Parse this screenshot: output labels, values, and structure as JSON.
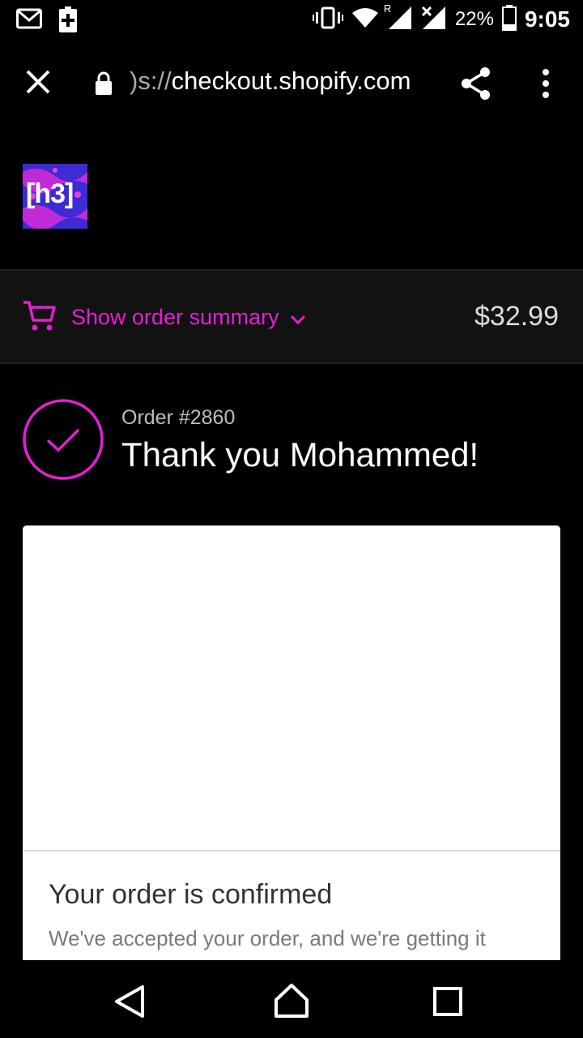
{
  "status_bar": {
    "battery_percent": "22%",
    "time": "9:05",
    "signal_roaming": "R",
    "icons": [
      "gmail-icon",
      "battery-plus-icon",
      "vibrate-icon",
      "wifi-icon",
      "signal-icon",
      "signal-off-icon",
      "battery-icon"
    ]
  },
  "browser": {
    "url_prefix": ")s://",
    "url_domain": "checkout.shopify.com",
    "icons": [
      "close-icon",
      "lock-icon",
      "share-icon",
      "more-vert-icon"
    ]
  },
  "store": {
    "logo_text": "[h3]"
  },
  "order_summary": {
    "label": "Show order summary",
    "total": "$32.99",
    "accent_color": "#e51fd4"
  },
  "confirmation": {
    "order_number": "Order #2860",
    "thank_you": "Thank you Mohammed!"
  },
  "card": {
    "title": "Your order is confirmed",
    "body": "We've accepted your order, and we're getting it"
  },
  "nav": {
    "icons": [
      "back-icon",
      "home-icon",
      "recents-icon"
    ]
  }
}
